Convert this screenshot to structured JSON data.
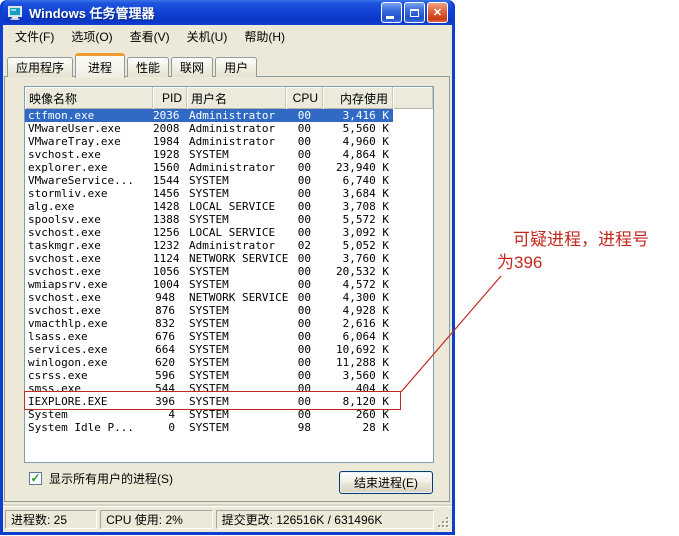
{
  "window": {
    "title": "Windows 任务管理器"
  },
  "titlebar": {
    "icons": [
      "task-manager-app-icon",
      "minimize-icon",
      "maximize-icon",
      "close-icon"
    ],
    "close_glyph": "✕"
  },
  "menu": {
    "items": [
      "文件(F)",
      "选项(O)",
      "查看(V)",
      "关机(U)",
      "帮助(H)"
    ]
  },
  "tabs": [
    {
      "label": "应用程序",
      "active": false
    },
    {
      "label": "进程",
      "active": true
    },
    {
      "label": "性能",
      "active": false
    },
    {
      "label": "联网",
      "active": false
    },
    {
      "label": "用户",
      "active": false
    }
  ],
  "process_table": {
    "columns": [
      "映像名称",
      "PID",
      "用户名",
      "CPU",
      "内存使用"
    ],
    "rows": [
      {
        "name": "ctfmon.exe",
        "pid": "2036",
        "user": "Administrator",
        "cpu": "00",
        "mem": "3,416 K",
        "selected": true,
        "flagged": false
      },
      {
        "name": "VMwareUser.exe",
        "pid": "2008",
        "user": "Administrator",
        "cpu": "00",
        "mem": "5,560 K",
        "selected": false,
        "flagged": false
      },
      {
        "name": "VMwareTray.exe",
        "pid": "1984",
        "user": "Administrator",
        "cpu": "00",
        "mem": "4,960 K",
        "selected": false,
        "flagged": false
      },
      {
        "name": "svchost.exe",
        "pid": "1928",
        "user": "SYSTEM",
        "cpu": "00",
        "mem": "4,864 K",
        "selected": false,
        "flagged": false
      },
      {
        "name": "explorer.exe",
        "pid": "1560",
        "user": "Administrator",
        "cpu": "00",
        "mem": "23,940 K",
        "selected": false,
        "flagged": false
      },
      {
        "name": "VMwareService...",
        "pid": "1544",
        "user": "SYSTEM",
        "cpu": "00",
        "mem": "6,740 K",
        "selected": false,
        "flagged": false
      },
      {
        "name": "stormliv.exe",
        "pid": "1456",
        "user": "SYSTEM",
        "cpu": "00",
        "mem": "3,684 K",
        "selected": false,
        "flagged": false
      },
      {
        "name": "alg.exe",
        "pid": "1428",
        "user": "LOCAL SERVICE",
        "cpu": "00",
        "mem": "3,708 K",
        "selected": false,
        "flagged": false
      },
      {
        "name": "spoolsv.exe",
        "pid": "1388",
        "user": "SYSTEM",
        "cpu": "00",
        "mem": "5,572 K",
        "selected": false,
        "flagged": false
      },
      {
        "name": "svchost.exe",
        "pid": "1256",
        "user": "LOCAL SERVICE",
        "cpu": "00",
        "mem": "3,092 K",
        "selected": false,
        "flagged": false
      },
      {
        "name": "taskmgr.exe",
        "pid": "1232",
        "user": "Administrator",
        "cpu": "02",
        "mem": "5,052 K",
        "selected": false,
        "flagged": false
      },
      {
        "name": "svchost.exe",
        "pid": "1124",
        "user": "NETWORK SERVICE",
        "cpu": "00",
        "mem": "3,760 K",
        "selected": false,
        "flagged": false
      },
      {
        "name": "svchost.exe",
        "pid": "1056",
        "user": "SYSTEM",
        "cpu": "00",
        "mem": "20,532 K",
        "selected": false,
        "flagged": false
      },
      {
        "name": "wmiapsrv.exe",
        "pid": "1004",
        "user": "SYSTEM",
        "cpu": "00",
        "mem": "4,572 K",
        "selected": false,
        "flagged": false
      },
      {
        "name": "svchost.exe",
        "pid": "948",
        "user": "NETWORK SERVICE",
        "cpu": "00",
        "mem": "4,300 K",
        "selected": false,
        "flagged": false
      },
      {
        "name": "svchost.exe",
        "pid": "876",
        "user": "SYSTEM",
        "cpu": "00",
        "mem": "4,928 K",
        "selected": false,
        "flagged": false
      },
      {
        "name": "vmacthlp.exe",
        "pid": "832",
        "user": "SYSTEM",
        "cpu": "00",
        "mem": "2,616 K",
        "selected": false,
        "flagged": false
      },
      {
        "name": "lsass.exe",
        "pid": "676",
        "user": "SYSTEM",
        "cpu": "00",
        "mem": "6,064 K",
        "selected": false,
        "flagged": false
      },
      {
        "name": "services.exe",
        "pid": "664",
        "user": "SYSTEM",
        "cpu": "00",
        "mem": "10,692 K",
        "selected": false,
        "flagged": false
      },
      {
        "name": "winlogon.exe",
        "pid": "620",
        "user": "SYSTEM",
        "cpu": "00",
        "mem": "11,288 K",
        "selected": false,
        "flagged": false
      },
      {
        "name": "csrss.exe",
        "pid": "596",
        "user": "SYSTEM",
        "cpu": "00",
        "mem": "3,560 K",
        "selected": false,
        "flagged": false
      },
      {
        "name": "smss.exe",
        "pid": "544",
        "user": "SYSTEM",
        "cpu": "00",
        "mem": "404 K",
        "selected": false,
        "flagged": false
      },
      {
        "name": "IEXPLORE.EXE",
        "pid": "396",
        "user": "SYSTEM",
        "cpu": "00",
        "mem": "8,120 K",
        "selected": false,
        "flagged": true
      },
      {
        "name": "System",
        "pid": "4",
        "user": "SYSTEM",
        "cpu": "00",
        "mem": "260 K",
        "selected": false,
        "flagged": false
      },
      {
        "name": "System Idle P...",
        "pid": "0",
        "user": "SYSTEM",
        "cpu": "98",
        "mem": "28 K",
        "selected": false,
        "flagged": false
      }
    ]
  },
  "footer": {
    "show_all_label": "显示所有用户的进程(S)",
    "show_all_checked": true,
    "check_glyph": "✓",
    "end_process_label": "结束进程(E)"
  },
  "statusbar": {
    "panels": [
      "进程数: 25",
      "CPU 使用: 2%",
      "提交更改: 126516K / 631496K"
    ]
  },
  "annotation": {
    "line1": "可疑进程，进程号",
    "line2": "为396",
    "color": "#c22a20"
  },
  "colors": {
    "titlebar_blue": "#1243d4",
    "selection_blue": "#316ac5",
    "window_bg": "#ece9d8",
    "annotation_red": "#c22a20",
    "active_tab_accent": "#ef9b33"
  }
}
